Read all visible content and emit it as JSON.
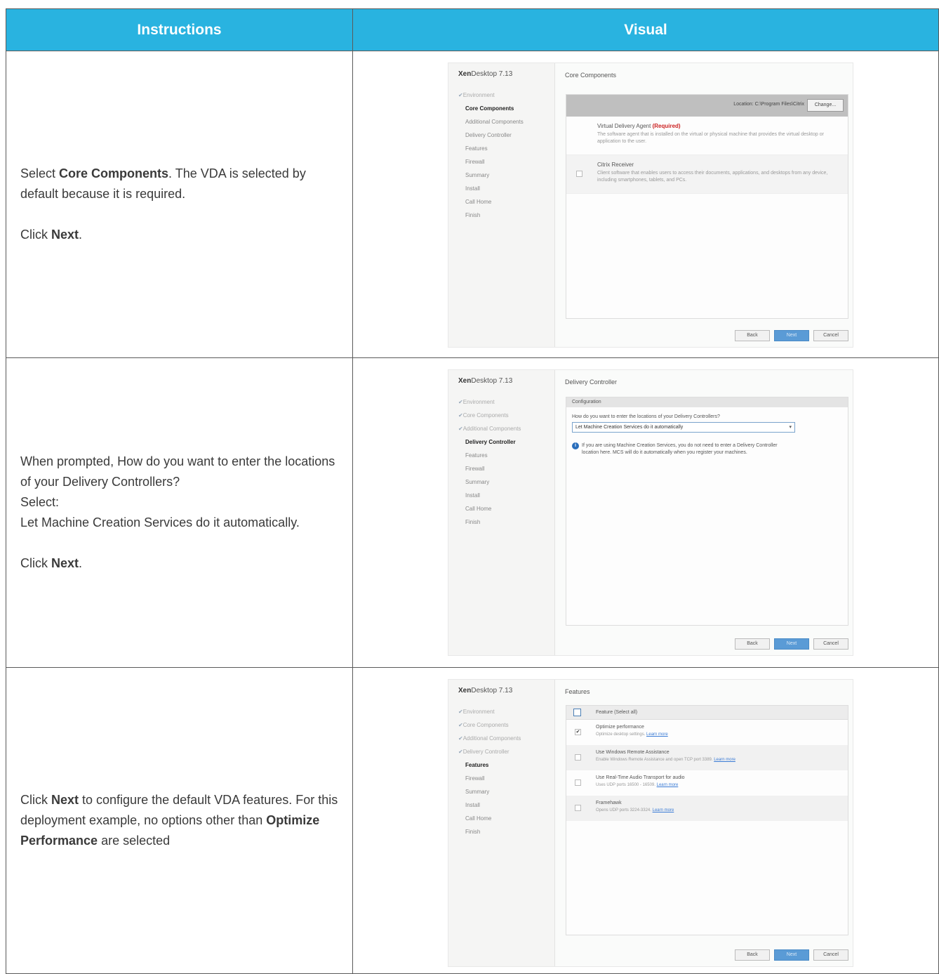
{
  "header": {
    "instructions": "Instructions",
    "visual": "Visual"
  },
  "rows": [
    {
      "instr": [
        [
          {
            "t": "Select "
          },
          {
            "t": "Core Components",
            "b": true
          },
          {
            "t": ". The VDA is selected by default because it is required."
          }
        ],
        null,
        [
          {
            "t": "Click "
          },
          {
            "t": "Next",
            "b": true
          },
          {
            "t": "."
          }
        ]
      ]
    },
    {
      "instr": [
        [
          {
            "t": "When prompted, How do you want to enter the locations of your Delivery Controllers?"
          }
        ],
        [
          {
            "t": "Select:"
          }
        ],
        [
          {
            "t": "Let Machine Creation Services do it automatically."
          }
        ],
        null,
        [
          {
            "t": "Click "
          },
          {
            "t": "Next",
            "b": true
          },
          {
            "t": "."
          }
        ]
      ]
    },
    {
      "instr": [
        [
          {
            "t": "Click "
          },
          {
            "t": "Next",
            "b": true
          },
          {
            "t": " to configure the default VDA features. For this deployment example, no options other than "
          },
          {
            "t": "Optimize Performance",
            "b": true
          },
          {
            "t": " are selected"
          }
        ]
      ]
    }
  ],
  "installer": {
    "brand_bold": "Xen",
    "brand_rest": "Desktop 7.13",
    "buttons": {
      "back": "Back",
      "next": "Next",
      "cancel": "Cancel"
    }
  },
  "screen1": {
    "title": "Core Components",
    "steps": [
      {
        "label": "Environment",
        "state": "done"
      },
      {
        "label": "Core Components",
        "state": "active"
      },
      {
        "label": "Additional Components",
        "state": "todo"
      },
      {
        "label": "Delivery Controller",
        "state": "todo"
      },
      {
        "label": "Features",
        "state": "todo"
      },
      {
        "label": "Firewall",
        "state": "todo"
      },
      {
        "label": "Summary",
        "state": "todo"
      },
      {
        "label": "Install",
        "state": "todo"
      },
      {
        "label": "Call Home",
        "state": "todo"
      },
      {
        "label": "Finish",
        "state": "todo"
      }
    ],
    "location": "Location: C:\\Program Files\\Citrix",
    "change": "Change...",
    "vda_title": "Virtual Delivery Agent",
    "vda_required": "(Required)",
    "vda_desc": "The software agent that is installed on the virtual or physical machine that provides the virtual desktop or application to the user.",
    "receiver_title": "Citrix Receiver",
    "receiver_desc": "Client software that enables users to access their documents, applications, and desktops from any device, including smartphones, tablets, and PCs."
  },
  "screen2": {
    "title": "Delivery Controller",
    "steps": [
      {
        "label": "Environment",
        "state": "done"
      },
      {
        "label": "Core Components",
        "state": "done"
      },
      {
        "label": "Additional Components",
        "state": "done"
      },
      {
        "label": "Delivery Controller",
        "state": "active"
      },
      {
        "label": "Features",
        "state": "todo"
      },
      {
        "label": "Firewall",
        "state": "todo"
      },
      {
        "label": "Summary",
        "state": "todo"
      },
      {
        "label": "Install",
        "state": "todo"
      },
      {
        "label": "Call Home",
        "state": "todo"
      },
      {
        "label": "Finish",
        "state": "todo"
      }
    ],
    "config": "Configuration",
    "question": "How do you want to enter the locations of your Delivery Controllers?",
    "selected": "Let Machine Creation Services do it automatically",
    "info": "If you are using Machine Creation Services, you do not need to enter a Delivery Controller location here. MCS will do it automatically when you register your machines."
  },
  "screen3": {
    "title": "Features",
    "steps": [
      {
        "label": "Environment",
        "state": "done"
      },
      {
        "label": "Core Components",
        "state": "done"
      },
      {
        "label": "Additional Components",
        "state": "done"
      },
      {
        "label": "Delivery Controller",
        "state": "done"
      },
      {
        "label": "Features",
        "state": "active"
      },
      {
        "label": "Firewall",
        "state": "todo"
      },
      {
        "label": "Summary",
        "state": "todo"
      },
      {
        "label": "Install",
        "state": "todo"
      },
      {
        "label": "Call Home",
        "state": "todo"
      },
      {
        "label": "Finish",
        "state": "todo"
      }
    ],
    "header": "Feature (Select all)",
    "learn_more": "Learn more",
    "features": [
      {
        "title": "Optimize performance",
        "desc": "Optimize desktop settings.",
        "checked": true
      },
      {
        "title": "Use Windows Remote Assistance",
        "desc": "Enable Windows Remote Assistance and open TCP port 3389.",
        "checked": false
      },
      {
        "title": "Use Real-Time Audio Transport for audio",
        "desc": "Uses UDP ports 16500 - 16509.",
        "checked": false
      },
      {
        "title": "Framehawk",
        "desc": "Opens UDP ports 3224-3324.",
        "checked": false
      }
    ]
  }
}
